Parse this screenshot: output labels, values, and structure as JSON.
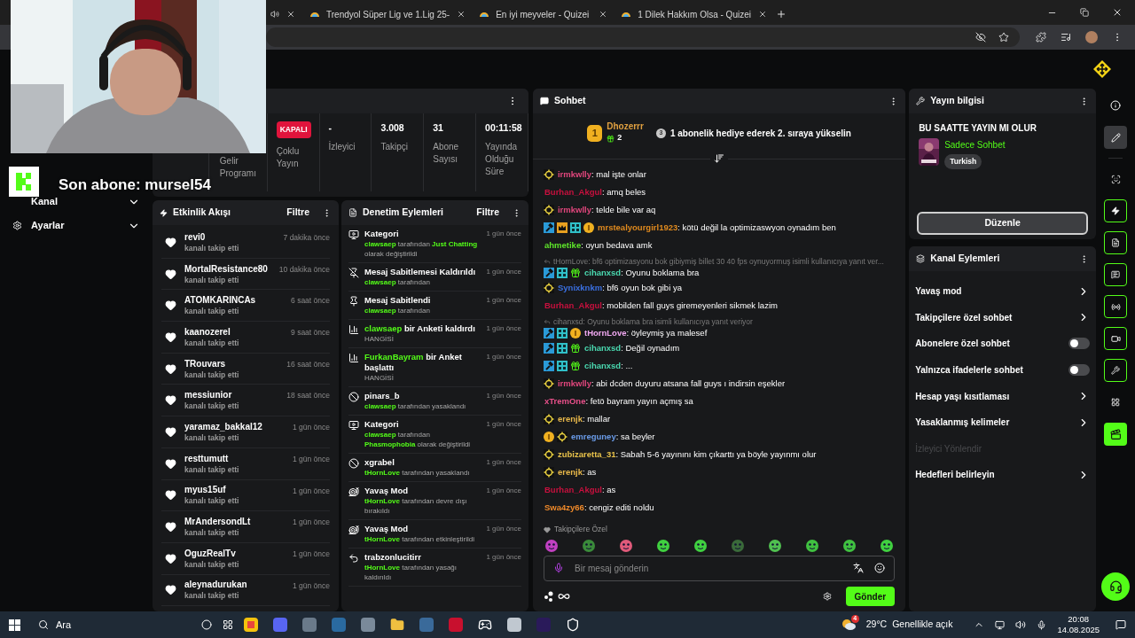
{
  "browser": {
    "tabs": [
      {
        "title": "Trendyol Süper Lig ve 1.Lig 25-",
        "selected": false
      },
      {
        "title": "En iyi meyveler - Quizei",
        "selected": false
      },
      {
        "title": "1 Dilek Hakkım Olsa - Quizei",
        "selected": false
      }
    ]
  },
  "overlay": {
    "latest_sub": "Son abone: mursel54"
  },
  "sidebar": {
    "items": [
      {
        "label": "Kanal",
        "kind": "plain"
      },
      {
        "label": "Ayarlar",
        "kind": "settings"
      }
    ]
  },
  "stats": {
    "cells": [
      {
        "kind": "label_only",
        "label": "Gelir Programı"
      },
      {
        "kind": "badge",
        "badge": "KAPALI",
        "label": "Çoklu Yayın"
      },
      {
        "kind": "value",
        "value": "-",
        "label": "İzleyici"
      },
      {
        "kind": "value",
        "value": "3.008",
        "label": "Takipçi"
      },
      {
        "kind": "value",
        "value": "31",
        "label": "Abone Sayısı"
      },
      {
        "kind": "value",
        "value": "00:11:58",
        "label": "Yayında Olduğu Süre"
      }
    ]
  },
  "activity": {
    "title": "Etkinlik Akışı",
    "filter": "Filtre",
    "items": [
      {
        "name": "revi0",
        "action": "kanalı takip etti",
        "time": "7 dakika önce"
      },
      {
        "name": "MortalResistance80",
        "action": "kanalı takip etti",
        "time": "10 dakika önce"
      },
      {
        "name": "ATOMKARINCAs",
        "action": "kanalı takip etti",
        "time": "6 saat önce"
      },
      {
        "name": "kaanozerel",
        "action": "kanalı takip etti",
        "time": "9 saat önce"
      },
      {
        "name": "TRouvars",
        "action": "kanalı takip etti",
        "time": "16 saat önce"
      },
      {
        "name": "messiunior",
        "action": "kanalı takip etti",
        "time": "18 saat önce"
      },
      {
        "name": "yaramaz_bakkal12",
        "action": "kanalı takip etti",
        "time": "1 gün önce"
      },
      {
        "name": "resttumutt",
        "action": "kanalı takip etti",
        "time": "1 gün önce"
      },
      {
        "name": "myus15uf",
        "action": "kanalı takip etti",
        "time": "1 gün önce"
      },
      {
        "name": "MrAndersondLt",
        "action": "kanalı takip etti",
        "time": "1 gün önce"
      },
      {
        "name": "OguzRealTv",
        "action": "kanalı takip etti",
        "time": "1 gün önce"
      },
      {
        "name": "aleynadurukan",
        "action": "kanalı takip etti",
        "time": "1 gün önce"
      }
    ]
  },
  "moderation": {
    "title": "Denetim Eylemleri",
    "filter": "Filtre",
    "items": [
      {
        "kind": "category",
        "time": "1 gün önce",
        "title": [
          {
            "text": "Kategori",
            "highlight": false
          }
        ],
        "detail": [
          {
            "text": "clawsaep",
            "highlight": true
          },
          {
            "text": " tarafından ",
            "highlight": false
          },
          {
            "text": "Just Chatting",
            "highlight": true
          },
          {
            "text": " olarak değiştirildi",
            "highlight": false
          }
        ]
      },
      {
        "kind": "unpin",
        "time": "1 gün önce",
        "title": [
          {
            "text": "Mesaj Sabitlemesi Kaldırıldı",
            "highlight": false
          }
        ],
        "detail": [
          {
            "text": "clawsaep",
            "highlight": true
          },
          {
            "text": " tarafından",
            "highlight": false
          }
        ]
      },
      {
        "kind": "pin",
        "time": "1 gün önce",
        "title": [
          {
            "text": "Mesaj Sabitlendi",
            "highlight": false
          }
        ],
        "detail": [
          {
            "text": "clawsaep",
            "highlight": true
          },
          {
            "text": " tarafından",
            "highlight": false
          }
        ]
      },
      {
        "kind": "poll",
        "time": "1 gün önce",
        "title": [
          {
            "text": "clawsaep",
            "highlight": true
          },
          {
            "text": " bir Anketi kaldırdı",
            "highlight": false
          }
        ],
        "detail": [
          {
            "text": "HANGİSİ",
            "highlight": false
          }
        ]
      },
      {
        "kind": "poll",
        "time": "1 gün önce",
        "title": [
          {
            "text": "FurkanBayram",
            "highlight": true
          },
          {
            "text": " bir Anket başlattı",
            "highlight": false
          }
        ],
        "detail": [
          {
            "text": "HANGİSİ",
            "highlight": false
          }
        ]
      },
      {
        "kind": "ban",
        "time": "1 gün önce",
        "title": [
          {
            "text": "pinars_b",
            "highlight": false
          }
        ],
        "detail": [
          {
            "text": "clawsaep",
            "highlight": true
          },
          {
            "text": " tarafından yasaklandı",
            "highlight": false
          }
        ]
      },
      {
        "kind": "category",
        "time": "1 gün önce",
        "title": [
          {
            "text": "Kategori",
            "highlight": false
          }
        ],
        "detail": [
          {
            "text": "clawsaep",
            "highlight": true
          },
          {
            "text": " tarafından ",
            "highlight": false
          },
          {
            "text": "Phasmophobia",
            "highlight": true
          },
          {
            "text": " olarak değiştirildi",
            "highlight": false
          }
        ]
      },
      {
        "kind": "ban",
        "time": "1 gün önce",
        "title": [
          {
            "text": "xgrabel",
            "highlight": false
          }
        ],
        "detail": [
          {
            "text": "tHornLove",
            "highlight": true
          },
          {
            "text": " tarafından yasaklandı",
            "highlight": false
          }
        ]
      },
      {
        "kind": "slow",
        "time": "1 gün önce",
        "title": [
          {
            "text": "Yavaş Mod",
            "highlight": false
          }
        ],
        "detail": [
          {
            "text": "tHornLove",
            "highlight": true
          },
          {
            "text": " tarafından devre dışı bırakıldı",
            "highlight": false
          }
        ]
      },
      {
        "kind": "slow",
        "time": "1 gün önce",
        "title": [
          {
            "text": "Yavaş Mod",
            "highlight": false
          }
        ],
        "detail": [
          {
            "text": "tHornLove",
            "highlight": true
          },
          {
            "text": " tarafından etkinleştirildi",
            "highlight": false
          }
        ]
      },
      {
        "kind": "unban",
        "time": "1 gün önce",
        "title": [
          {
            "text": "trabzonlucitirr",
            "highlight": false
          }
        ],
        "detail": [
          {
            "text": "tHornLove",
            "highlight": true
          },
          {
            "text": " tarafından yasağı kaldırıldı",
            "highlight": false
          }
        ]
      }
    ]
  },
  "chat": {
    "title": "Sohbet",
    "separator": ":",
    "pinned": {
      "rank": "1",
      "name": "Dhozerrr",
      "gifts": "2",
      "next_rank": "3",
      "prompt": "1 abonelik hediye ederek 2. sıraya yükselin"
    },
    "messages": [
      {
        "badges": [
          {
            "kind": "star"
          }
        ],
        "name": "irmkwlly",
        "color": "#e0467c",
        "text": "mal işte onlar"
      },
      {
        "name": "Burhan_Akgul",
        "color": "#c8103e",
        "text": "amq beles"
      },
      {
        "badges": [
          {
            "kind": "star"
          }
        ],
        "name": "irmkwlly",
        "color": "#e0467c",
        "text": "telde bile var aq"
      },
      {
        "badges": [
          {
            "kind": "mod"
          },
          {
            "kind": "crown"
          },
          {
            "kind": "og"
          },
          {
            "kind": "sub"
          }
        ],
        "name": "mrstealyourgirl1923",
        "color": "#e08a1e",
        "text": "kötü değil la optimizaswyon oynadım ben"
      },
      {
        "name": "ahmetike",
        "color": "#5ee62a",
        "text": "oyun bedava amk"
      },
      {
        "reply": "tHornLove: bf6 optimizasyonu bok gibiymiş billet 30 40 fps oynuyormuş isimli kullanıcıya yanıt ver...",
        "badges": [
          {
            "kind": "mod"
          },
          {
            "kind": "og"
          },
          {
            "kind": "gift"
          }
        ],
        "name": "cihanxsd",
        "color": "#4ad9b0",
        "text": "Oyunu boklama bra"
      },
      {
        "badges": [
          {
            "kind": "star"
          }
        ],
        "name": "Synixknkm",
        "color": "#3a6fe0",
        "text": "bf6 oyun bok gibi ya"
      },
      {
        "name": "Burhan_Akgul",
        "color": "#c8103e",
        "text": "mobilden fall guys giremeyenleri sikmek lazim"
      },
      {
        "reply": "cihanxsd: Oyunu boklama bra isimli kullanıcıya yanıt veriyor",
        "badges": [
          {
            "kind": "mod"
          },
          {
            "kind": "og"
          },
          {
            "kind": "sub"
          }
        ],
        "name": "tHornLove",
        "color": "#f0a8f0",
        "text": "öyleymiş ya malesef"
      },
      {
        "badges": [
          {
            "kind": "mod"
          },
          {
            "kind": "og"
          },
          {
            "kind": "gift"
          }
        ],
        "name": "cihanxsd",
        "color": "#4ad9b0",
        "text": "Değil oynadım"
      },
      {
        "badges": [
          {
            "kind": "mod"
          },
          {
            "kind": "og"
          },
          {
            "kind": "gift"
          }
        ],
        "name": "cihanxsd",
        "color": "#4ad9b0",
        "text": "..."
      },
      {
        "badges": [
          {
            "kind": "star"
          }
        ],
        "name": "irmkwlly",
        "color": "#e0467c",
        "text": "abi dcden duyuru atsana fall guys ı indirsin eşekler"
      },
      {
        "name": "xTremOne",
        "color": "#e8508a",
        "text": "fetö bayram yayın açmış sa"
      },
      {
        "badges": [
          {
            "kind": "star"
          }
        ],
        "name": "erenjk",
        "color": "#e8b84a",
        "text": "mallar"
      },
      {
        "badges": [
          {
            "kind": "sub"
          },
          {
            "kind": "star"
          }
        ],
        "name": "emreguney",
        "color": "#6a9be8",
        "text": "sa beyler"
      },
      {
        "badges": [
          {
            "kind": "star"
          }
        ],
        "name": "zubizaretta_31",
        "color": "#e8c24a",
        "text": "Sabah 5-6 yayınını kim çıkarttı ya böyle yayınmı olur"
      },
      {
        "badges": [
          {
            "kind": "star"
          }
        ],
        "name": "erenjk",
        "color": "#e8b84a",
        "text": "as"
      },
      {
        "name": "Burhan_Akgul",
        "color": "#c8103e",
        "text": "as"
      },
      {
        "name": "Swa4zy66",
        "color": "#f08a2a",
        "text": "cengiz editi noldu"
      }
    ],
    "emote_section": "Takipçilere Özel",
    "input": {
      "placeholder": "Bir mesaj gönderin"
    },
    "send": "Gönder"
  },
  "stream_info": {
    "title": "Yayın bilgisi",
    "stream_title": "BU SAATTE YAYIN MI OLUR",
    "category": "Sadece Sohbet",
    "tag": "Turkish",
    "edit": "Düzenle"
  },
  "channel_actions": {
    "title": "Kanal Eylemleri",
    "items": [
      {
        "kind": "link",
        "label": "Yavaş mod",
        "disabled": false
      },
      {
        "kind": "link",
        "label": "Takipçilere özel sohbet",
        "disabled": false
      },
      {
        "kind": "toggle",
        "label": "Abonelere özel sohbet",
        "on": false,
        "disabled": false
      },
      {
        "kind": "toggle",
        "label": "Yalnızca ifadelerle sohbet",
        "on": false,
        "disabled": false
      },
      {
        "kind": "link",
        "label": "Hesap yaşı kısıtlaması",
        "disabled": false
      },
      {
        "kind": "link",
        "label": "Yasaklanmış kelimeler",
        "disabled": false
      },
      {
        "kind": "plain",
        "label": "İzleyici Yönlendir",
        "disabled": true
      },
      {
        "kind": "link",
        "label": "Hedefleri belirleyin",
        "disabled": false
      }
    ]
  },
  "taskbar": {
    "search": "Ara",
    "weather_badge": "4",
    "temperature": "29°C",
    "weather": "Genellikle açık",
    "time": "20:08",
    "date": "14.08.2025"
  }
}
